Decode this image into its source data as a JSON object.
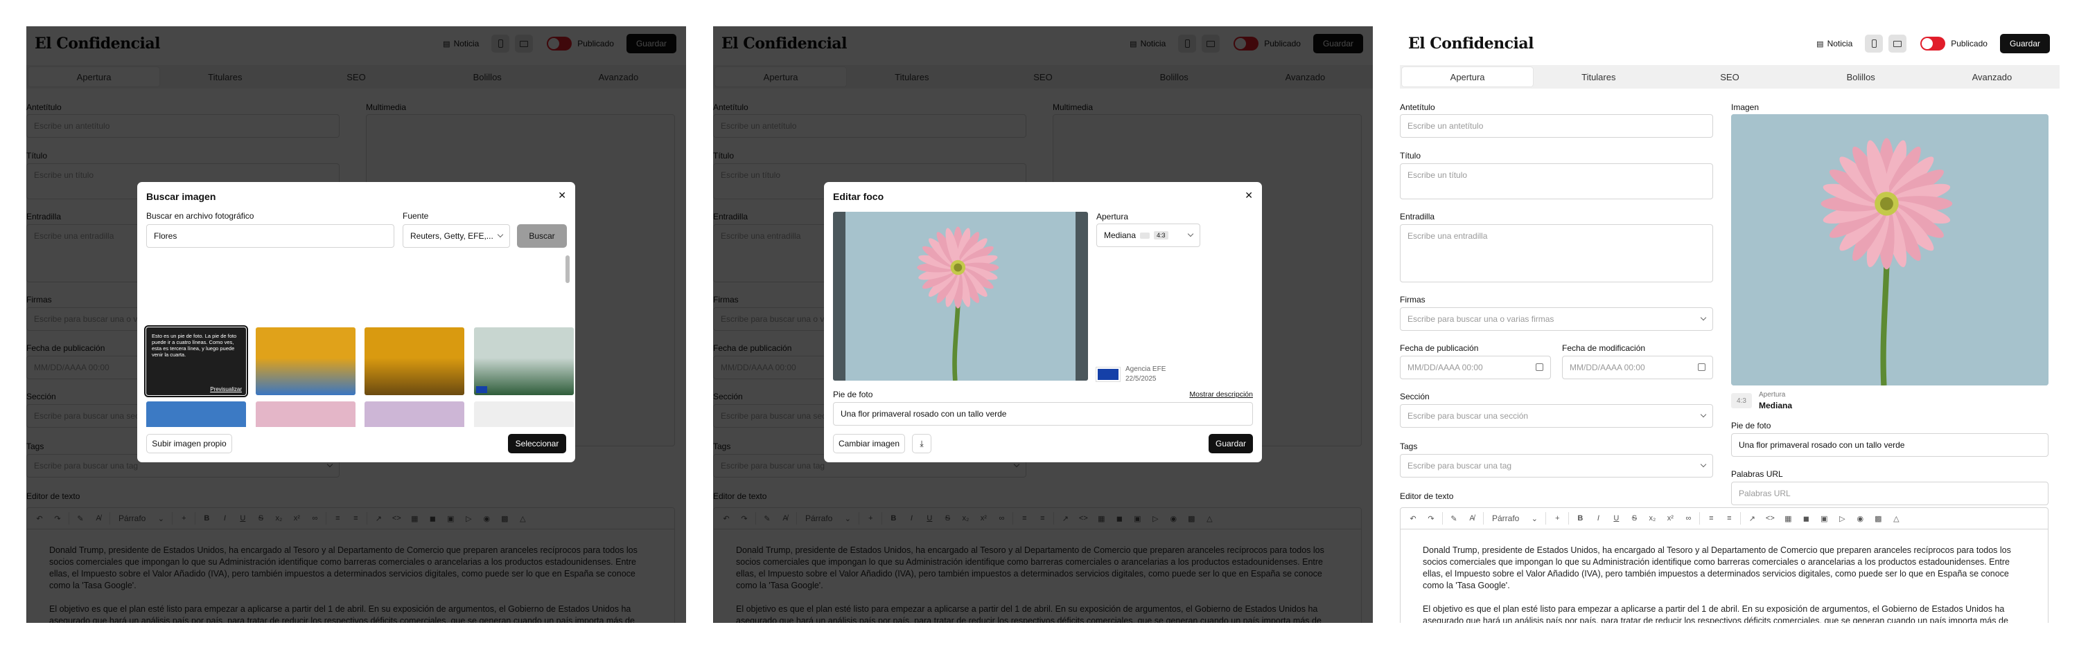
{
  "app": {
    "brand": "El Confidencial",
    "noticia_label": "Noticia",
    "publish_label": "Publicado",
    "save_label": "Guardar",
    "accent": "#e11d2a"
  },
  "tabs": [
    "Apertura",
    "Titulares",
    "SEO",
    "Bolillos",
    "Avanzado"
  ],
  "form": {
    "antetitulo_label": "Antetítulo",
    "antetitulo_placeholder": "Escribe un antetítulo",
    "titulo_label": "Título",
    "titulo_placeholder": "Escribe un título",
    "entradilla_label": "Entradilla",
    "entradilla_placeholder": "Escribe una entradilla",
    "firmas_label": "Firmas",
    "firmas_placeholder": "Escribe para buscar una o varias firmas",
    "fecha_pub_label": "Fecha de publicación",
    "fecha_mod_label": "Fecha de modificación",
    "fecha_placeholder": "MM/DD/AAAA 00:00",
    "seccion_label": "Sección",
    "seccion_placeholder": "Escribe para buscar una sección",
    "tags_label": "Tags",
    "tags_placeholder": "Escribe para buscar una tag",
    "editor_label": "Editor de texto",
    "imagen_label": "Imagen",
    "multimedia_label": "Multimedia",
    "apertura_small": "Apertura",
    "apertura_value": "Mediana",
    "ratio": "4:3",
    "pie_label": "Pie de foto",
    "pie_value": "Una flor primaveral rosado con un tallo verde",
    "palabras_label": "Palabras URL",
    "palabras_placeholder": "Palabras URL"
  },
  "editor": {
    "paragraph_style": "Párrafo",
    "p1": "Donald Trump, presidente de Estados Unidos, ha encargado al Tesoro y al Departamento de Comercio que preparen aranceles recíprocos para todos los socios comerciales que impongan lo que su Administración identifique como barreras comerciales o arancelarias a los productos estadounidenses. Entre ellas, el Impuesto sobre el Valor Añadido (IVA), pero también impuestos a determinados servicios digitales, como puede ser lo que en España se conoce como la 'Tasa Google'.",
    "p2": "El objetivo es que el plan esté listo para empezar a aplicarse a partir del 1 de abril. En su exposición de argumentos, el Gobierno de Estados Unidos ha asegurado que hará un análisis país por país, para tratar de reducir los respectivos déficits comerciales, que se generan cuando un país importa más de"
  },
  "search_modal": {
    "title": "Buscar imagen",
    "search_label": "Buscar en archivo fotográfico",
    "search_value": "Flores",
    "source_label": "Fuente",
    "source_value": "Reuters, Getty, EFE,...",
    "search_button": "Buscar",
    "first_caption": "Esto es un pie de foto. La pie de foto puede ir a cuatro líneas. Como ves, esta es tercera línea, y luego puede venir la cuarta.",
    "preview_link": "Previsualizar",
    "upload_button": "Subir imagen propio",
    "select_button": "Seleccionar"
  },
  "focus_modal": {
    "title": "Editar foco",
    "apertura_label": "Apertura",
    "apertura_value": "Mediana",
    "ratio": "4:3",
    "agency": "Agencia EFE",
    "date": "22/5/2025",
    "pie_label": "Pie de foto",
    "show_desc": "Mostrar descripción",
    "pie_value": "Una flor primaveral rosado con un tallo verde",
    "change_button": "Cambiar imagen",
    "save_button": "Guardar"
  }
}
